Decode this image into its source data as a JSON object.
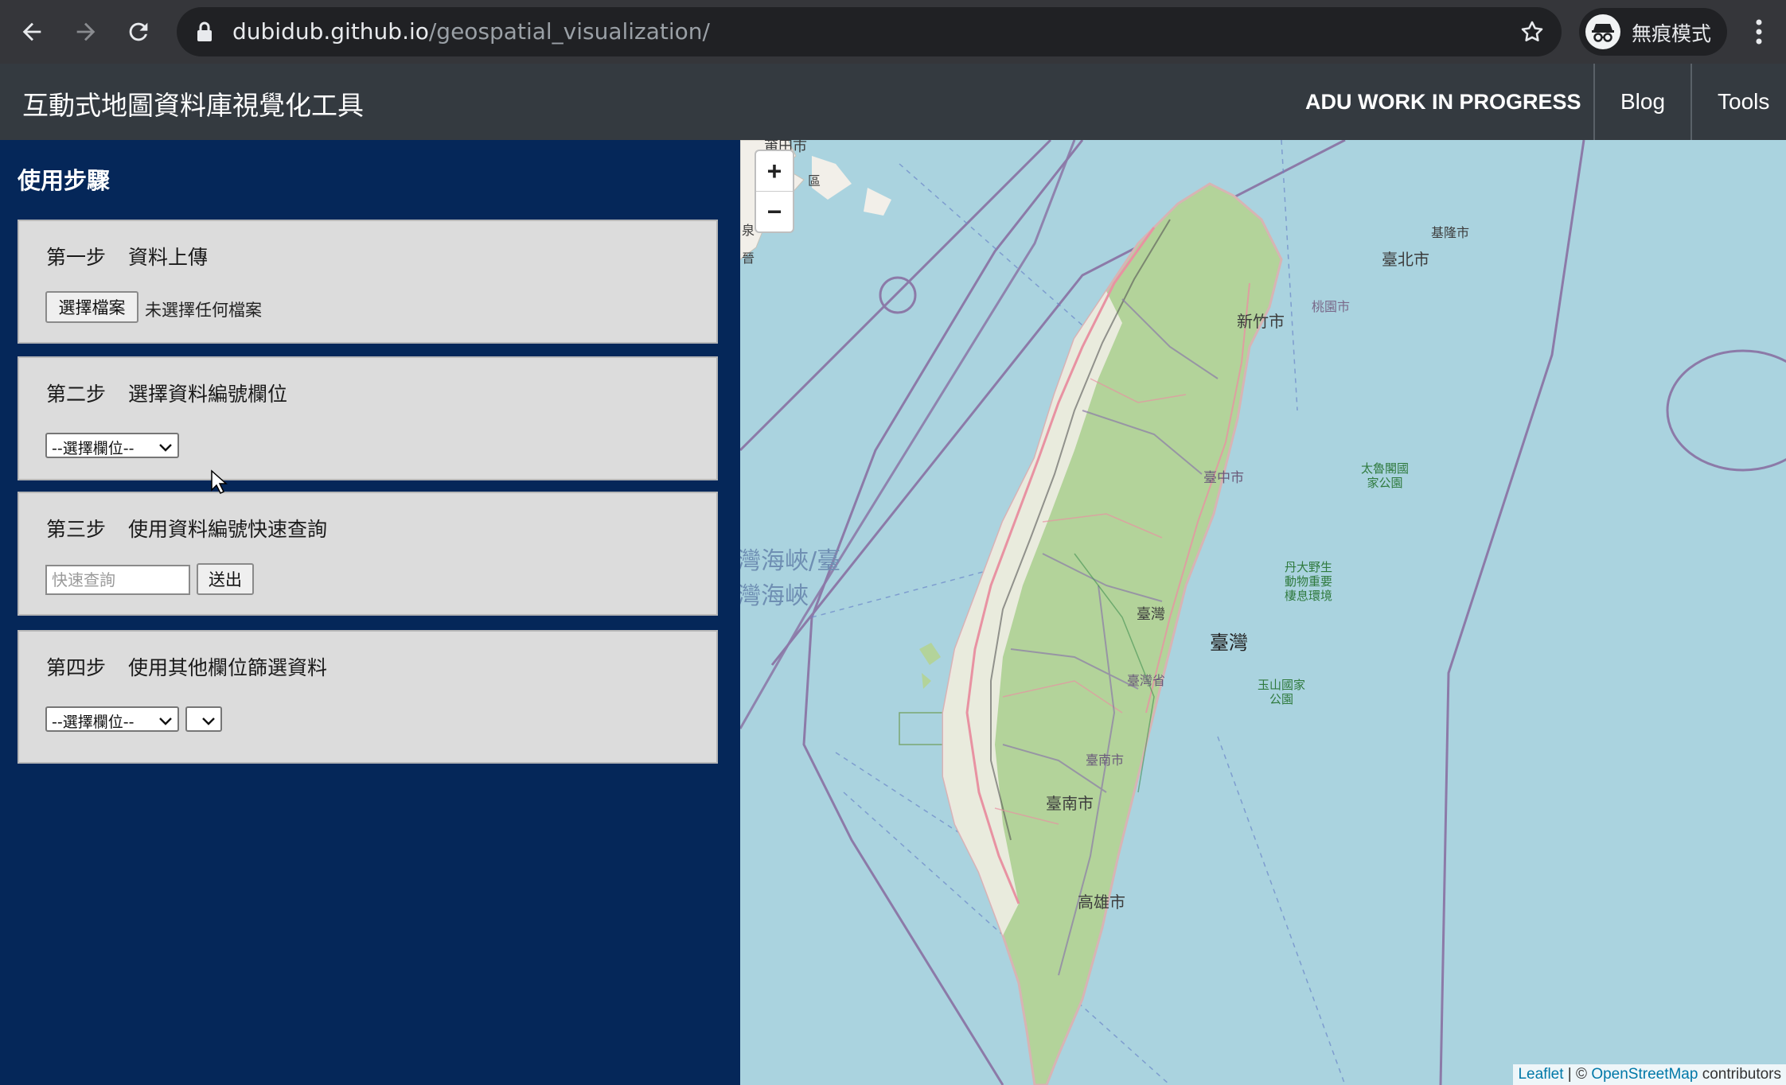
{
  "browser": {
    "url_host": "dubidub.github.io",
    "url_path": "/geospatial_visualization/",
    "incognito_label": "無痕模式",
    "icons": [
      "back-arrow-icon",
      "forward-arrow-icon",
      "reload-icon",
      "lock-icon",
      "star-icon",
      "incognito-icon",
      "more-menu-icon"
    ]
  },
  "navbar": {
    "brand": "互動式地圖資料庫視覺化工具",
    "links": [
      "ADU WORK IN PROGRESS",
      "Blog",
      "Tools"
    ]
  },
  "sidebar": {
    "title": "使用步驟",
    "steps": [
      {
        "step": "第一步",
        "label": "資料上傳",
        "button": "選擇檔案",
        "status": "未選擇任何檔案"
      },
      {
        "step": "第二步",
        "label": "選擇資料編號欄位",
        "select": "--選擇欄位--"
      },
      {
        "step": "第三步",
        "label": "使用資料編號快速查詢",
        "placeholder": "快速查詢",
        "button": "送出"
      },
      {
        "step": "第四步",
        "label": "使用其他欄位篩選資料",
        "select": "--選擇欄位--",
        "select2": ""
      }
    ]
  },
  "map": {
    "zoom_in": "+",
    "zoom_out": "−",
    "labels": {
      "keelung": "基隆市",
      "taipei": "臺北市",
      "taoyuan": "桃園市",
      "hsinchu": "新竹市",
      "taichung": "臺中市",
      "taroko": "太魯閣國\n家公園",
      "dajia": "丹大野生\n動物重要\n棲息環境",
      "taiwan1": "臺灣",
      "taiwan_island": "臺灣",
      "taiwan_province": "臺灣省",
      "yushan": "玉山國家\n公園",
      "tainan_small": "臺南市",
      "tainan": "臺南市",
      "kaohsiung": "高雄市",
      "strait": "灣海峽/臺\n灣海峽",
      "top_left1": "莆田市",
      "top_left2": "區",
      "top_left3": "泉",
      "top_left4": "晉"
    },
    "attribution": {
      "leaflet": "Leaflet",
      "sep": " | © ",
      "osm": "OpenStreetMap",
      "suffix": " contributors"
    },
    "colors": {
      "sea": "#aad3df",
      "land": "#b3d39a",
      "urban": "#f2efe9",
      "road": "#e892a2",
      "boundary": "#8c7aa8"
    }
  }
}
